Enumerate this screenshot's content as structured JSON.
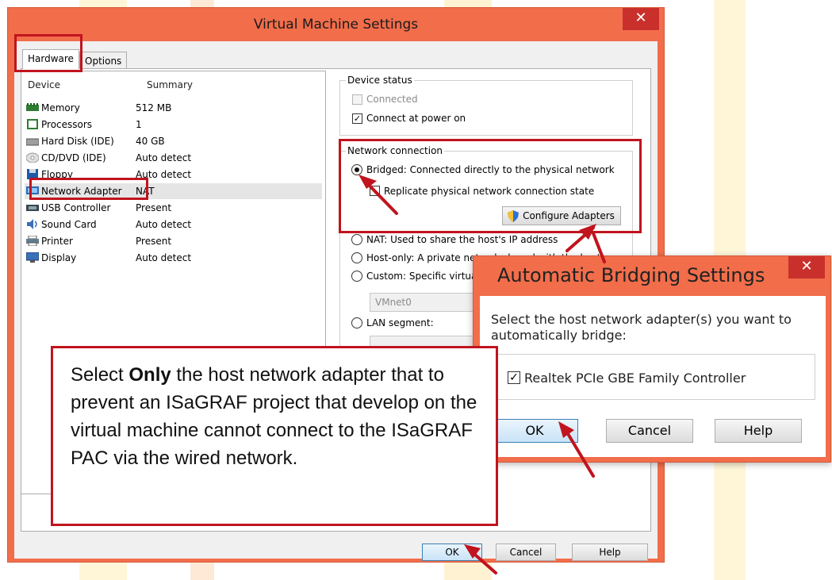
{
  "window": {
    "title": "Virtual Machine Settings",
    "close_glyph": "✕"
  },
  "tabs": [
    {
      "label": "Hardware"
    },
    {
      "label": "Options"
    }
  ],
  "device_list": {
    "header_device": "Device",
    "header_summary": "Summary",
    "rows": [
      {
        "name": "Memory",
        "summary": "512 MB",
        "icon": "memory-icon"
      },
      {
        "name": "Processors",
        "summary": "1",
        "icon": "processor-icon"
      },
      {
        "name": "Hard Disk (IDE)",
        "summary": "40 GB",
        "icon": "hard-disk-icon"
      },
      {
        "name": "CD/DVD (IDE)",
        "summary": "Auto detect",
        "icon": "cd-dvd-icon"
      },
      {
        "name": "Floppy",
        "summary": "Auto detect",
        "icon": "floppy-icon"
      },
      {
        "name": "Network Adapter",
        "summary": "NAT",
        "icon": "network-adapter-icon"
      },
      {
        "name": "USB Controller",
        "summary": "Present",
        "icon": "usb-icon"
      },
      {
        "name": "Sound Card",
        "summary": "Auto detect",
        "icon": "sound-card-icon"
      },
      {
        "name": "Printer",
        "summary": "Present",
        "icon": "printer-icon"
      },
      {
        "name": "Display",
        "summary": "Auto detect",
        "icon": "display-icon"
      }
    ]
  },
  "device_status": {
    "title": "Device status",
    "connected_label": "Connected",
    "connect_power_label": "Connect at power on"
  },
  "network_connection": {
    "title": "Network connection",
    "bridged_label": "Bridged: Connected directly to the physical network",
    "replicate_label": "Replicate physical network connection state",
    "configure_label": "Configure Adapters",
    "nat_label": "NAT: Used to share the host's IP address",
    "hostonly_label": "Host-only: A private net",
    "hostonly_tail": "ork shared with the host",
    "custom_label": "Custom: Specific virtua",
    "vmnet_value": "VMnet0",
    "lan_label": "LAN segment:"
  },
  "footer": {
    "ok": "OK",
    "cancel": "Cancel",
    "help": "Help"
  },
  "bridging_dialog": {
    "title": "Automatic Bridging Settings",
    "close_glyph": "✕",
    "prompt_line1": "Select the host network adapter(s) you want to",
    "prompt_line2": "automatically bridge:",
    "adapter_label": "Realtek PCIe GBE Family Controller",
    "ok": "OK",
    "cancel": "Cancel",
    "help": "Help"
  },
  "callout": {
    "pre": "Select ",
    "bold": "Only",
    "post": " the host network adapter that to prevent an ISaGRAF project that develop on the virtual machine cannot connect to the ISaGRAF PAC via the wired network."
  },
  "colors": {
    "title_bar": "#f26d4a",
    "highlight_red": "#c0141e",
    "close_red": "#c9302c"
  }
}
